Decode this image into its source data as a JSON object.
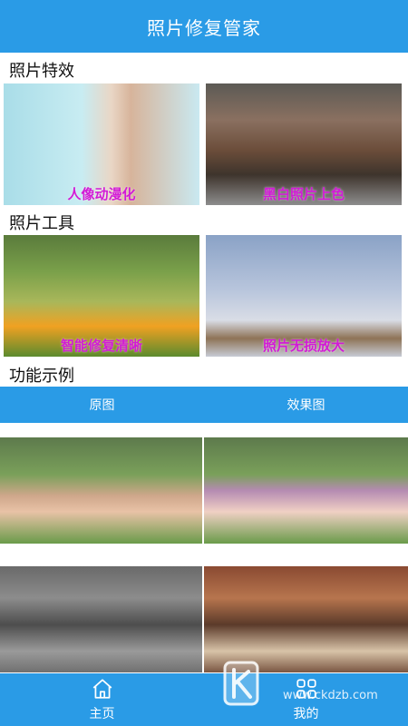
{
  "header": {
    "title": "照片修复管家"
  },
  "sections": {
    "effects": "照片特效",
    "tools": "照片工具",
    "examples": "功能示例"
  },
  "cards": {
    "anime": "人像动漫化",
    "bw": "黑白照片上色",
    "repair": "智能修复清晰",
    "enlarge": "照片无损放大"
  },
  "compare": {
    "original": "原图",
    "result": "效果图"
  },
  "tabs": {
    "home": "主页",
    "mine": "我的"
  },
  "icons": {
    "home": "home-icon",
    "mine": "grid-icon"
  },
  "watermark": {
    "url": "www.ckdzb.com"
  },
  "colors": {
    "primary": "#2a9be6",
    "label": "#d21bd6"
  }
}
